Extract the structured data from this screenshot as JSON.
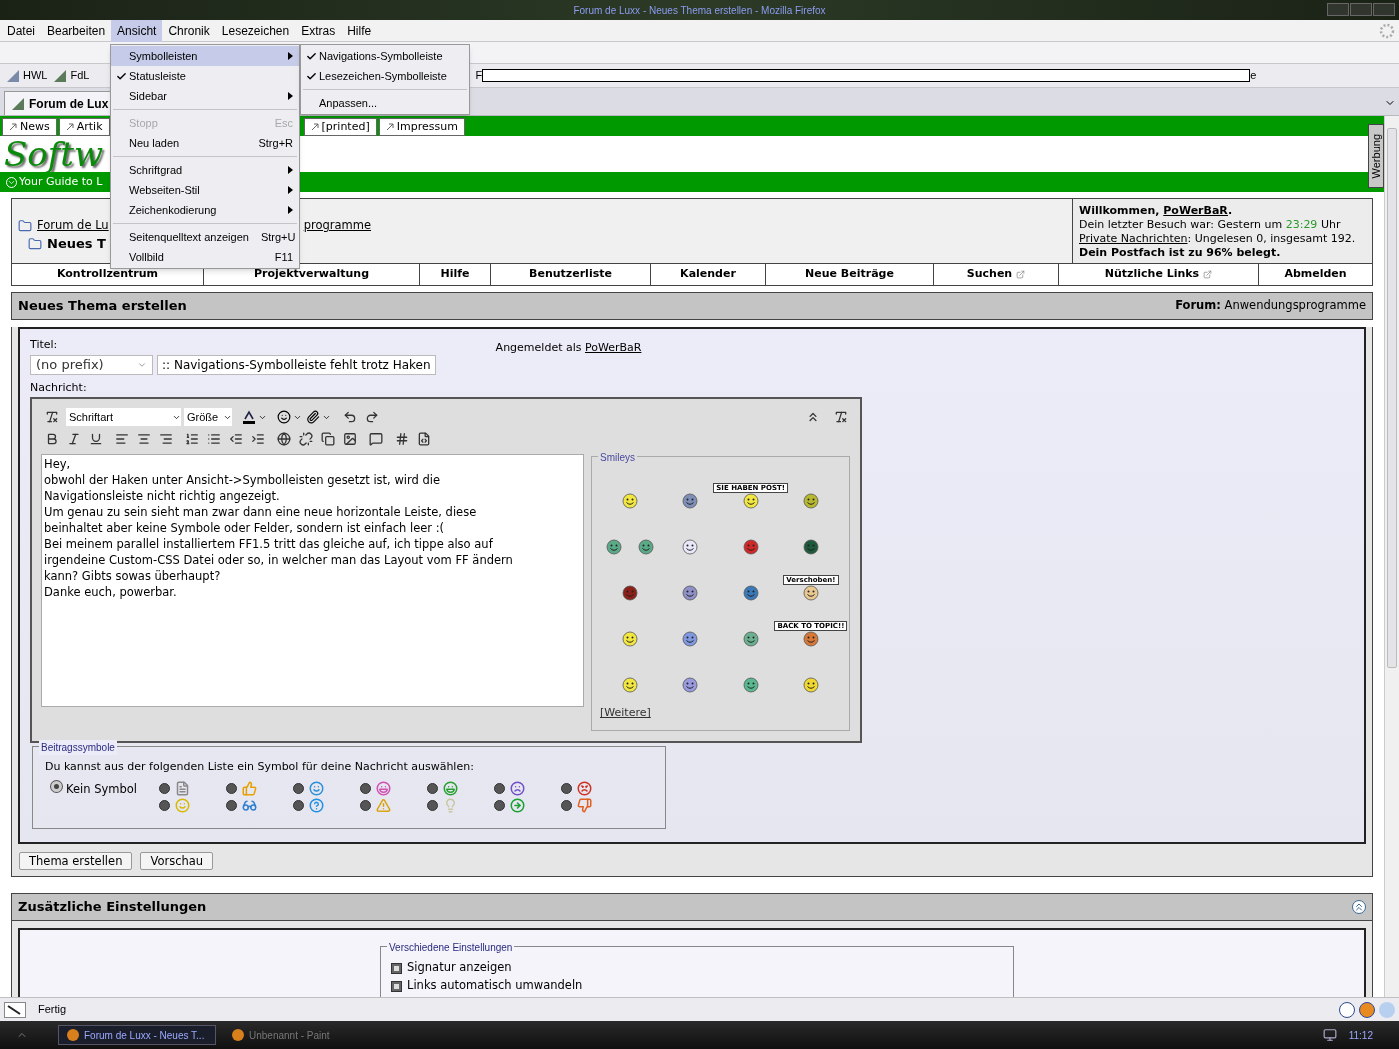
{
  "window": {
    "title": "Forum de Luxx - Neues Thema erstellen - Mozilla Firefox"
  },
  "menu_bar": [
    {
      "label": "Datei",
      "selected": false
    },
    {
      "label": "Bearbeiten",
      "selected": false
    },
    {
      "label": "Ansicht",
      "selected": true
    },
    {
      "label": "Chronik",
      "selected": false
    },
    {
      "label": "Lesezeichen",
      "selected": false
    },
    {
      "label": "Extras",
      "selected": false
    },
    {
      "label": "Hilfe",
      "selected": false
    }
  ],
  "view_menu": [
    {
      "kind": "submenu",
      "label": "Symbolleisten",
      "selected": true,
      "disabled": false
    },
    {
      "kind": "check",
      "label": "Statusleiste",
      "checked": true,
      "selected": false,
      "disabled": false
    },
    {
      "kind": "submenu",
      "label": "Sidebar",
      "selected": false,
      "disabled": false
    },
    {
      "kind": "separator"
    },
    {
      "kind": "command",
      "label": "Stopp",
      "shortcut": "Esc",
      "selected": false,
      "disabled": true
    },
    {
      "kind": "command",
      "label": "Neu laden",
      "shortcut": "Strg+R",
      "selected": false,
      "disabled": false
    },
    {
      "kind": "separator"
    },
    {
      "kind": "submenu",
      "label": "Schriftgrad",
      "selected": false,
      "disabled": false
    },
    {
      "kind": "submenu",
      "label": "Webseiten-Stil",
      "selected": false,
      "disabled": false
    },
    {
      "kind": "submenu",
      "label": "Zeichenkodierung",
      "selected": false,
      "disabled": false
    },
    {
      "kind": "separator"
    },
    {
      "kind": "command",
      "label": "Seitenquelltext anzeigen",
      "shortcut": "Strg+U",
      "selected": false,
      "disabled": false
    },
    {
      "kind": "command",
      "label": "Vollbild",
      "shortcut": "F11",
      "selected": false,
      "disabled": false
    }
  ],
  "toolbars_submenu": [
    {
      "kind": "check",
      "label": "Navigations-Symbolleiste",
      "checked": true,
      "selected": false,
      "disabled": false
    },
    {
      "kind": "check",
      "label": "Lesezeichen-Symbolleiste",
      "checked": true,
      "selected": false,
      "disabled": false
    },
    {
      "kind": "separator"
    },
    {
      "kind": "command",
      "label": "Anpassen...",
      "selected": false,
      "disabled": false
    }
  ],
  "bookmarks_toolbar": {
    "items": [
      "HWL",
      "FdL"
    ],
    "fragment_left": "F",
    "fragment_right": "e"
  },
  "tabs": [
    {
      "label": "Forum de Lux",
      "selected": true
    }
  ],
  "site_nav": {
    "left": [
      "News",
      "Artik"
    ],
    "right": [
      "[printed]",
      "Impressum"
    ]
  },
  "banner": {
    "logo": "Softw",
    "tagline": "Your Guide to L",
    "ad_tab": "Werbung"
  },
  "breadcrumb": {
    "root": "Forum de Lu",
    "forum": "programme",
    "current": "Neues T"
  },
  "welcome": {
    "greeting": "Willkommen,",
    "user": "PoWerBaR",
    "greeting_end": ".",
    "last_visit": "Dein letzter Besuch war: Gestern um",
    "last_visit_time": "23:29",
    "last_visit_end": "Uhr",
    "pm_link": "Private Nachrichten",
    "pm_text": ": Ungelesen 0, insgesamt 192.",
    "quota": "Dein Postfach ist zu 96% belegt."
  },
  "nav_buttons": [
    {
      "label": "Kontrollzentrum",
      "external": false
    },
    {
      "label": "Projektverwaltung",
      "external": false
    },
    {
      "label": "Hilfe",
      "external": false
    },
    {
      "label": "Benutzerliste",
      "external": false
    },
    {
      "label": "Kalender",
      "external": false
    },
    {
      "label": "Neue Beiträge",
      "external": false
    },
    {
      "label": "Suchen",
      "external": true
    },
    {
      "label": "Nützliche Links",
      "external": true
    },
    {
      "label": "Abmelden",
      "external": false
    }
  ],
  "post": {
    "title": "Neues Thema erstellen",
    "forum_label": "Forum:",
    "forum_name": "Anwendungsprogramme"
  },
  "form": {
    "title_label": "Titel:",
    "prefix": "(no prefix)",
    "subject": ":: Navigations-Symbolleiste fehlt trotz Haken",
    "logged_in": "Angemeldet als",
    "user": "PoWerBaR",
    "message_label": "Nachricht:",
    "font": "Schriftart",
    "size": "Größe",
    "message": [
      "Hey,",
      "obwohl der Haken unter Ansicht->Symbolleisten gesetzt ist, wird die",
      "Navigationsleiste nicht richtig angezeigt.",
      "Um genau zu sein sieht man zwar dann eine neue horizontale Leiste, diese",
      "beinhaltet aber keine Symbole oder Felder, sondern ist einfach leer :(",
      "Bei meinem parallel installiertem FF1.5 tritt das gleiche auf, ich tippe also auf",
      "irgendeine Custom-CSS Datei oder so, in welcher man das Layout vom FF ändern",
      "kann? Gibts sowas überhaupt?",
      "Danke euch, powerbar."
    ]
  },
  "smileys": {
    "legend": "Smileys",
    "more": "[Weitere]",
    "rows": [
      [
        [
          {
            "kind": "face",
            "color": "#f2e640"
          }
        ],
        [
          {
            "kind": "face",
            "color": "#7f8fb8"
          }
        ],
        [
          {
            "kind": "sign",
            "sign": "SIE HABEN POST!",
            "color": "#f2e640"
          }
        ],
        [
          {
            "kind": "face",
            "color": "#b8b830"
          }
        ]
      ],
      [
        [
          {
            "kind": "face",
            "color": "#5aaa88"
          },
          {
            "kind": "face",
            "color": "#5aaa88"
          }
        ],
        [
          {
            "kind": "face",
            "color": "#e8e8f8"
          }
        ],
        [
          {
            "kind": "face",
            "color": "#d02828"
          }
        ],
        [
          {
            "kind": "face",
            "color": "#1e5a3c"
          }
        ]
      ],
      [
        [
          {
            "kind": "face",
            "color": "#8a2018"
          }
        ],
        [
          {
            "kind": "face",
            "color": "#9090c8"
          }
        ],
        [
          {
            "kind": "face",
            "color": "#3a78b8"
          }
        ],
        [
          {
            "kind": "sign",
            "sign": "Verschoben!",
            "color": "#e8c890"
          }
        ]
      ],
      [
        [
          {
            "kind": "face",
            "color": "#f2e640"
          }
        ],
        [
          {
            "kind": "face",
            "color": "#8098e0"
          }
        ],
        [
          {
            "kind": "face",
            "color": "#6ab090"
          }
        ],
        [
          {
            "kind": "sign",
            "sign": "BACK TO TOPIC!!",
            "color": "#d87838"
          }
        ]
      ],
      [
        [
          {
            "kind": "face",
            "color": "#f2e640"
          }
        ],
        [
          {
            "kind": "face",
            "color": "#9a9ae0"
          }
        ],
        [
          {
            "kind": "face",
            "color": "#5ab890"
          }
        ],
        [
          {
            "kind": "face",
            "color": "#f0d830"
          }
        ]
      ]
    ]
  },
  "post_icons": {
    "legend": "Beitragssymbole",
    "instruction": "Du kannst aus der folgenden Liste ein Symbol für deine Nachricht auswählen:",
    "none_label": "Kein Symbol",
    "none_selected": true,
    "options": [
      {
        "selected": false
      },
      {
        "selected": false
      },
      {
        "selected": false
      },
      {
        "selected": false
      },
      {
        "selected": false
      },
      {
        "selected": false
      },
      {
        "selected": false
      },
      {
        "selected": false
      },
      {
        "selected": false
      },
      {
        "selected": false
      },
      {
        "selected": false
      },
      {
        "selected": false
      },
      {
        "selected": false
      },
      {
        "selected": false
      }
    ]
  },
  "buttons": [
    "Thema erstellen",
    "Vorschau"
  ],
  "extra": {
    "title": "Zusätzliche Einstellungen",
    "legend": "Verschiedene Einstellungen",
    "options": [
      {
        "label": "Signatur anzeigen",
        "checked": true
      },
      {
        "label": "Links automatisch umwandeln",
        "checked": true
      }
    ]
  },
  "status_bar": {
    "text": "Fertig"
  },
  "taskbar": {
    "items": [
      {
        "label": "Forum de Luxx - Neues T...",
        "selected": true
      },
      {
        "label": "Unbenannt - Paint",
        "selected": false
      }
    ],
    "clock": "11:12"
  }
}
